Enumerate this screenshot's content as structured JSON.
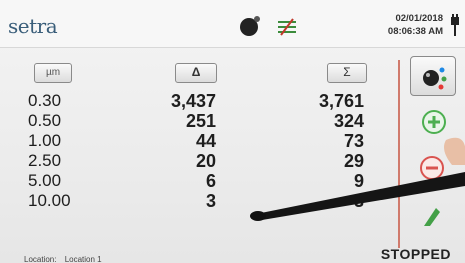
{
  "header": {
    "brand": "setra",
    "date": "02/01/2018",
    "time": "08:06:38 AM",
    "icons": [
      "camera-icon",
      "signal-icon",
      "plug-icon"
    ]
  },
  "columns": {
    "size_label": "µm",
    "delta_label": "Δ",
    "sigma_label": "Σ"
  },
  "rows": [
    {
      "size": "0.30",
      "delta": "3,437",
      "sigma": "3,761"
    },
    {
      "size": "0.50",
      "delta": "251",
      "sigma": "324"
    },
    {
      "size": "1.00",
      "delta": "44",
      "sigma": "73"
    },
    {
      "size": "2.50",
      "delta": "20",
      "sigma": "29"
    },
    {
      "size": "5.00",
      "delta": "6",
      "sigma": "9"
    },
    {
      "size": "10.00",
      "delta": "3",
      "sigma": "3"
    }
  ],
  "tools": [
    "settings-icon",
    "zoom-in-icon",
    "zoom-out-icon",
    "export-icon"
  ],
  "footer": {
    "location_label": "Location:",
    "location_value": "Location 1",
    "status": "STOPPED"
  },
  "colors": {
    "brand": "#3a5e7a",
    "zoom_in_green": "#4caf50",
    "zoom_out_red": "#d9534f",
    "divider": "#d07a6c"
  }
}
